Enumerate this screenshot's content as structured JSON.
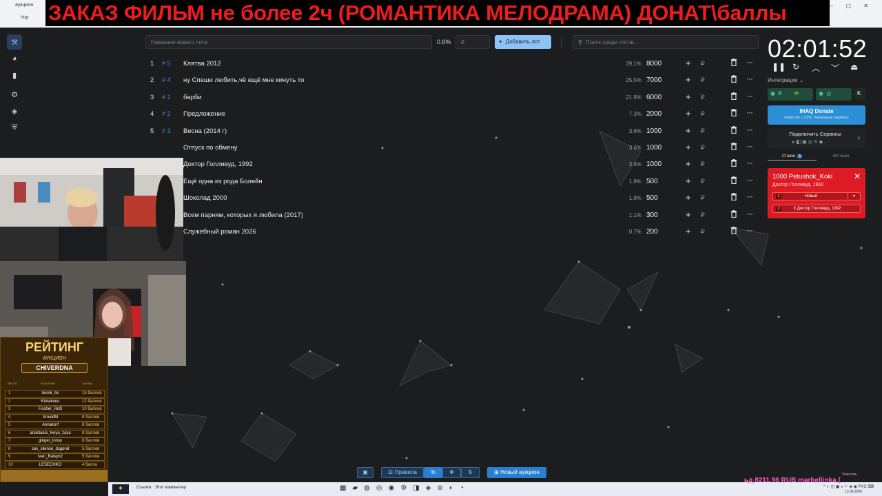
{
  "browser": {
    "tab_title": "аукцион",
    "url_fragment": "http",
    "banner_text": "ЗАКАЗ ФИЛЬМ не более 2ч (РОМАНТИКА МЕЛОДРАМА) ДОНАТ\\баллы"
  },
  "toolbar": {
    "lot_placeholder": "Название нового лота",
    "percent": "0.0%",
    "amount_placeholder": "₽",
    "add_lot_label": "Добавить лот",
    "search_placeholder": "Поиск среди лотов..."
  },
  "lots": [
    {
      "num": "1",
      "id": "# 5",
      "name": "Клятва 2012",
      "percent": "29.1%",
      "amount": "8000"
    },
    {
      "num": "2",
      "id": "# 4",
      "name": "ну Спеши любить,чё ещё мне кинуть то",
      "percent": "25.5%",
      "amount": "7000"
    },
    {
      "num": "3",
      "id": "# 1",
      "name": "барби",
      "percent": "21.8%",
      "amount": "6000"
    },
    {
      "num": "4",
      "id": "# 2",
      "name": "Предложение",
      "percent": "7.3%",
      "amount": "2000"
    },
    {
      "num": "5",
      "id": "# 3",
      "name": "Весна (2014 г)",
      "percent": "3.6%",
      "amount": "1000"
    },
    {
      "num": "",
      "id": "",
      "name": "Отпуск по обмену",
      "percent": "3.6%",
      "amount": "1000"
    },
    {
      "num": "",
      "id": "",
      "name": "Доктор Голливуд, 1992",
      "percent": "3.6%",
      "amount": "1000"
    },
    {
      "num": "",
      "id": "",
      "name": "Ещё одна из рода Болейн",
      "percent": "1.8%",
      "amount": "500"
    },
    {
      "num": "",
      "id": "",
      "name": "Шоколад 2000",
      "percent": "1.8%",
      "amount": "500"
    },
    {
      "num": "",
      "id": "",
      "name": "Всем парням, которых я любила (2017)",
      "percent": "1.1%",
      "amount": "300"
    },
    {
      "num": "",
      "id": "",
      "name": "Служебный роман 2026",
      "percent": "0.7%",
      "amount": "200"
    }
  ],
  "lot_row_symbols": {
    "plus": "+",
    "currency": "₽",
    "more": "···"
  },
  "rating": {
    "title": "РЕЙТИНГ",
    "subtitle": "АУКЦИОН",
    "streamer": "CHIVERDNA",
    "headers": {
      "place": "МЕСТО",
      "participant": "УЧАСТНИК",
      "points": "БАЛЛЫ"
    },
    "rows": [
      {
        "place": "1",
        "name": "lesnik_bs",
        "score": "18 баллов"
      },
      {
        "place": "2",
        "name": "Ktotakouu",
        "score": "12 баллов"
      },
      {
        "place": "3",
        "name": "Fischer_RnD",
        "score": "10 баллов"
      },
      {
        "place": "4",
        "name": "ArnoldM",
        "score": "9 баллов"
      },
      {
        "place": "5",
        "name": "Annakorf",
        "score": "8 баллов"
      },
      {
        "place": "6",
        "name": "anastasia_tvoya_zaya",
        "score": "8 баллов"
      },
      {
        "place": "7",
        "name": "ginger_lonsy",
        "score": "6 баллов"
      },
      {
        "place": "8",
        "name": "sos_silence_dsgond",
        "score": "5 баллов"
      },
      {
        "place": "9",
        "name": "ivan_Batsyn2",
        "score": "5 баллов"
      },
      {
        "place": "10",
        "name": "LESECHKO",
        "score": "4 балла"
      }
    ]
  },
  "timer": {
    "value": "02:01:52"
  },
  "integrations": {
    "label": "Интеграции",
    "currency": "₽"
  },
  "donate": {
    "title": "IHAQ Donate",
    "subtitle": "Комиссия – 3,5%. Уникальные виджеты!"
  },
  "connect": {
    "label": "Подключить Сервисы"
  },
  "bids_tabs": {
    "bids": "Ставки",
    "bids_count": "1",
    "history": "История"
  },
  "bid_card": {
    "title": "1000 Petushok_Koki",
    "subtitle": "Доктор Голливуд, 1992",
    "opt1_num": "1",
    "opt1_label": "Новый",
    "opt2_num": "2",
    "opt2_label": "К Доктор Голливуд, 1992"
  },
  "bottom": {
    "rules_label": "Правила",
    "new_auction_label": "Новый аукцион"
  },
  "taskbar": {
    "links_label": "Ссылки",
    "pc_label": "Этот компьютер",
    "tray_lang": "РУС",
    "date": "13.08.2026"
  },
  "ticker": {
    "text": "ьд  8211.96 RUB    marbellinka  (",
    "small": "Очистить"
  },
  "colors": {
    "accent": "#90c3f5",
    "bid_red": "#de1b24",
    "banner_red": "#ee1c1c",
    "donate_blue": "#2a8fd4"
  }
}
